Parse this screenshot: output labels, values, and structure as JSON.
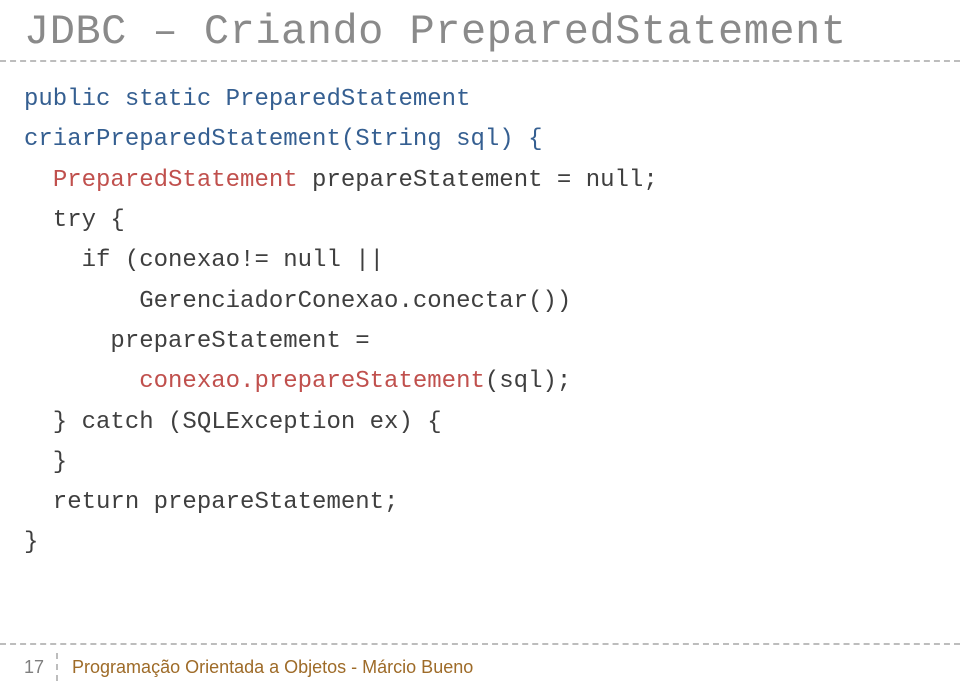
{
  "title": "JDBC – Criando PreparedStatement",
  "code": {
    "t1": "public static PreparedStatement",
    "t2": "criarPreparedStatement(String sql) {",
    "t3a": "PreparedStatement",
    "t3b": " prepareStatement = null;",
    "t4": "  try {",
    "t5": "    if (conexao!= null ||",
    "t6": "        GerenciadorConexao.conectar())",
    "t7": "      prepareStatement =",
    "t8a": "conexao.prepareStatement",
    "t8b": "(sql);",
    "t9": "  } catch (SQLException ex) {",
    "t10": "  }",
    "t11": "  return prepareStatement;",
    "t12": "}"
  },
  "footer": {
    "page": "17",
    "text": "Programação Orientada a Objetos - Márcio Bueno"
  }
}
